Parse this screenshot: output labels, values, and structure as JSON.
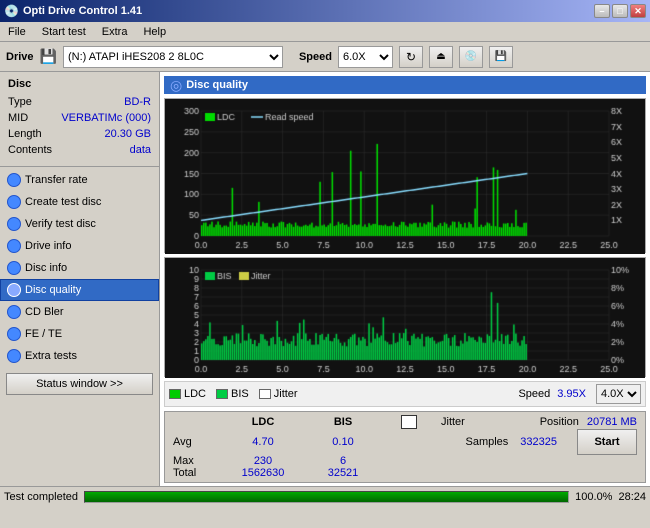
{
  "window": {
    "title": "Opti Drive Control 1.41",
    "icon": "⬜"
  },
  "titlebar_buttons": {
    "minimize": "–",
    "maximize": "□",
    "close": "✕"
  },
  "menu": {
    "items": [
      "File",
      "Start test",
      "Extra",
      "Help"
    ]
  },
  "drivebar": {
    "drive_label": "Drive",
    "drive_value": "(N:) ATAPI iHES208  2 8L0C",
    "speed_label": "Speed",
    "speed_value": "6.0X"
  },
  "disc_section": {
    "header": "Disc",
    "rows": [
      {
        "label": "Type",
        "value": "BD-R"
      },
      {
        "label": "MID",
        "value": "VERBATIMc (000)"
      },
      {
        "label": "Length",
        "value": "20.30 GB"
      },
      {
        "label": "Contents",
        "value": "data"
      }
    ]
  },
  "nav_items": [
    {
      "id": "transfer-rate",
      "label": "Transfer rate",
      "active": false
    },
    {
      "id": "create-test-disc",
      "label": "Create test disc",
      "active": false
    },
    {
      "id": "verify-test-disc",
      "label": "Verify test disc",
      "active": false
    },
    {
      "id": "drive-info",
      "label": "Drive info",
      "active": false
    },
    {
      "id": "disc-info",
      "label": "Disc info",
      "active": false
    },
    {
      "id": "disc-quality",
      "label": "Disc quality",
      "active": true
    },
    {
      "id": "cd-bler",
      "label": "CD Bler",
      "active": false
    },
    {
      "id": "fe-te",
      "label": "FE / TE",
      "active": false
    },
    {
      "id": "extra-tests",
      "label": "Extra tests",
      "active": false
    }
  ],
  "status_button": "Status window >>",
  "chart": {
    "title": "Disc quality",
    "top_legend": {
      "ldc_label": "LDC",
      "read_speed_label": "Read speed"
    },
    "bottom_legend": {
      "bis_label": "BIS",
      "jitter_label": "Jitter"
    },
    "speed_label": "Speed",
    "speed_value": "3.95X",
    "speed_select_value": "4.0X"
  },
  "stats": {
    "headers": [
      "",
      "LDC",
      "BIS"
    ],
    "rows": [
      {
        "label": "Avg",
        "ldc": "4.70",
        "bis": "0.10"
      },
      {
        "label": "Max",
        "ldc": "230",
        "bis": "6"
      },
      {
        "label": "Total",
        "ldc": "1562630",
        "bis": "32521"
      }
    ],
    "position_label": "Position",
    "position_value": "20781 MB",
    "samples_label": "Samples",
    "samples_value": "332325"
  },
  "start_button": "Start",
  "statusbar": {
    "text": "Test completed",
    "progress": 100,
    "percent": "100.0%",
    "time": "28:24"
  },
  "colors": {
    "accent_blue": "#316ac5",
    "ldc_green": "#00dd00",
    "read_speed_cyan": "#88ddff",
    "bis_green": "#00cc44",
    "jitter_yellow": "#cccc00",
    "chart_bg": "#111111",
    "chart_grid": "#333333"
  }
}
